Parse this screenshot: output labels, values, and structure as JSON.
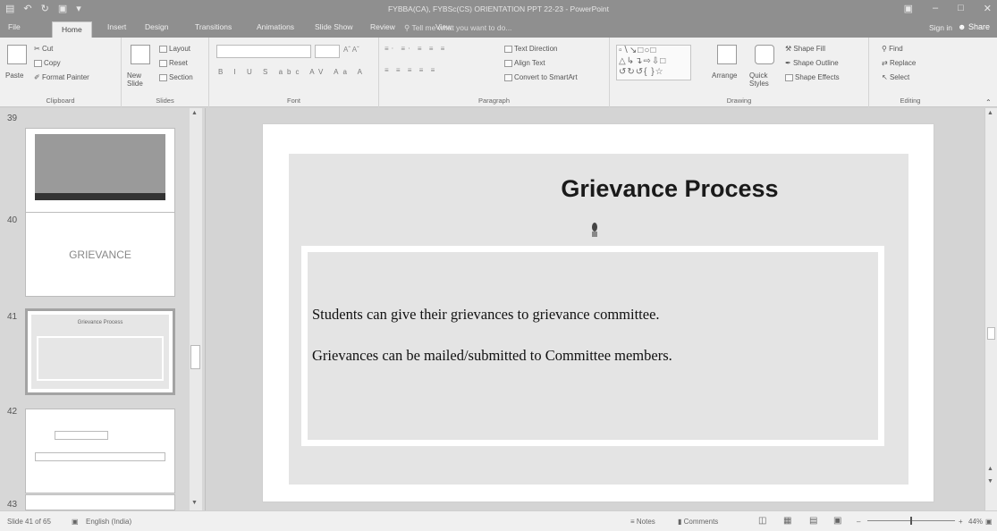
{
  "titlebar": {
    "title": "FYBBA(CA), FYBSc(CS) ORIENTATION PPT 22-23 - PowerPoint",
    "quick_access": [
      "save-icon",
      "undo-icon",
      "redo-icon",
      "present-icon",
      "customize-icon"
    ],
    "window_controls": [
      "ribbon-display-icon",
      "minimize-icon",
      "restore-icon",
      "close-icon"
    ]
  },
  "tabs": [
    "File",
    "Home",
    "Insert",
    "Design",
    "Transitions",
    "Animations",
    "Slide Show",
    "Review",
    "View"
  ],
  "tell_me": "Tell me what you want to do...",
  "sign_in": "Sign in",
  "share": "Share",
  "ribbon": {
    "clipboard": {
      "paste": "Paste",
      "cut": "Cut",
      "copy": "Copy",
      "format_painter": "Format Painter",
      "label": "Clipboard"
    },
    "slides": {
      "new_slide": "New Slide",
      "layout": "Layout",
      "reset": "Reset",
      "section": "Section",
      "label": "Slides"
    },
    "font": {
      "label": "Font",
      "buttons": "B I U S abc AV Aa A"
    },
    "paragraph": {
      "text_direction": "Text Direction",
      "align_text": "Align Text",
      "smartart": "Convert to SmartArt",
      "label": "Paragraph"
    },
    "drawing": {
      "arrange": "Arrange",
      "quick_styles": "Quick Styles",
      "shape_fill": "Shape Fill",
      "shape_outline": "Shape Outline",
      "shape_effects": "Shape Effects",
      "label": "Drawing"
    },
    "editing": {
      "find": "Find",
      "replace": "Replace",
      "select": "Select",
      "label": "Editing"
    }
  },
  "thumbnails": [
    {
      "number": "39",
      "title": ""
    },
    {
      "number": "40",
      "title": "GRIEVANCE"
    },
    {
      "number": "41",
      "title": "Grievance Process"
    },
    {
      "number": "42",
      "title": ""
    },
    {
      "number": "43",
      "title": ""
    }
  ],
  "slide": {
    "title": "Grievance Process",
    "bullets": [
      "Students can give their grievances to grievance committee.",
      "Grievances can be mailed/submitted to Committee members."
    ]
  },
  "statusbar": {
    "slide_info": "Slide 41 of 65",
    "language": "English (India)",
    "notes": "Notes",
    "comments": "Comments",
    "zoom": "44%"
  }
}
